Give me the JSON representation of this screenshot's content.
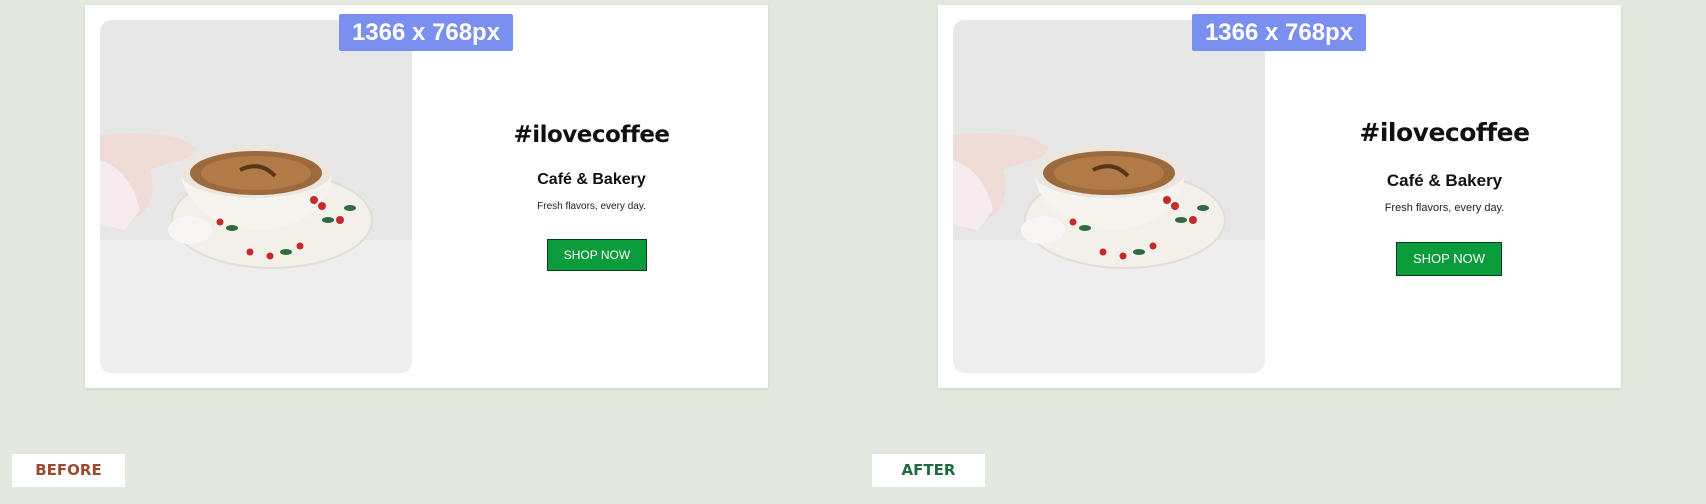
{
  "panels": {
    "before": {
      "size_badge": "1366 x 768px",
      "hashtag": "#ilovecoffee",
      "title": "Café & Bakery",
      "tagline": "Fresh flavors, every day.",
      "button_label": "SHOP NOW"
    },
    "after": {
      "size_badge": "1366 x 768px",
      "hashtag": "#ilovecoffee",
      "title": "Café & Bakery",
      "tagline": "Fresh flavors, every day.",
      "button_label": "SHOP NOW"
    }
  },
  "labels": {
    "before": "BEFORE",
    "after": "AFTER"
  },
  "colors": {
    "background": "#e3eadd",
    "badge": "#7b8ff0",
    "button": "#0a9c3a",
    "before_label": "#9a4a2e",
    "after_label": "#1f6a3f"
  },
  "icons": {
    "photo": "coffee-cup-photo"
  }
}
